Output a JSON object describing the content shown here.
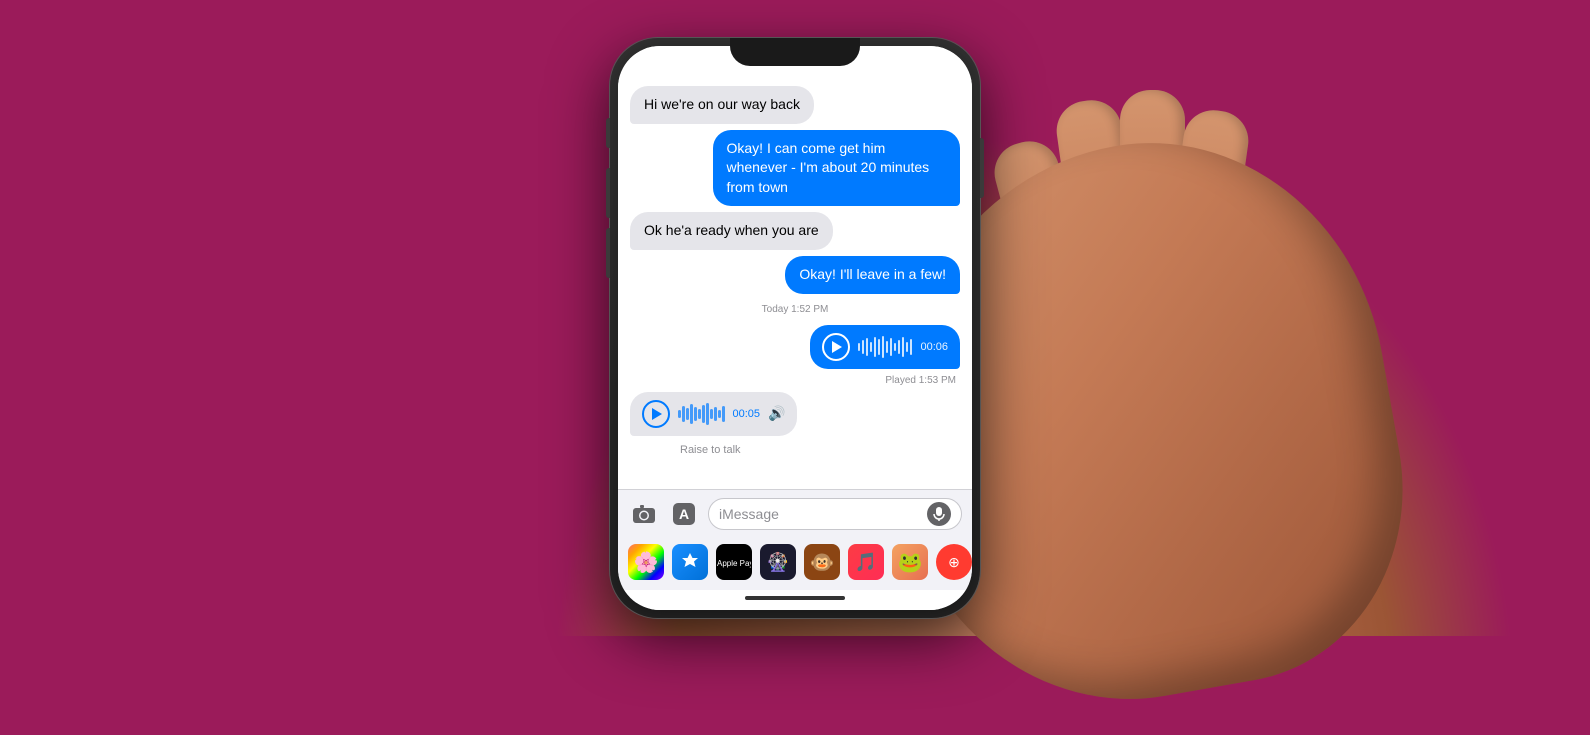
{
  "background_color": "#9b1b5a",
  "messages": [
    {
      "id": "msg1",
      "type": "received",
      "text": "Hi we're on our way back"
    },
    {
      "id": "msg2",
      "type": "sent",
      "text": "Okay! I can come get him whenever - I'm about 20 minutes from town"
    },
    {
      "id": "msg3",
      "type": "received",
      "text": "Ok he'a ready when you are"
    },
    {
      "id": "msg4",
      "type": "sent",
      "text": "Okay! I'll leave in a few!"
    }
  ],
  "timestamp": "Today 1:52 PM",
  "audio_sent": {
    "duration": "00:06",
    "status": "Played",
    "played_time": "1:53 PM"
  },
  "audio_received": {
    "duration": "00:05"
  },
  "raise_to_talk": "Raise to talk",
  "input": {
    "placeholder": "iMessage"
  },
  "app_icons": [
    {
      "name": "Photos",
      "type": "photos"
    },
    {
      "name": "App Store",
      "type": "appstore"
    },
    {
      "name": "Apple Pay",
      "type": "applepay"
    },
    {
      "name": "Music Wheel",
      "type": "music-wheel"
    },
    {
      "name": "Monkey",
      "type": "monkey"
    },
    {
      "name": "Apple Music",
      "type": "apple-music"
    },
    {
      "name": "Memoji",
      "type": "memoji"
    },
    {
      "name": "Red",
      "type": "red"
    }
  ]
}
